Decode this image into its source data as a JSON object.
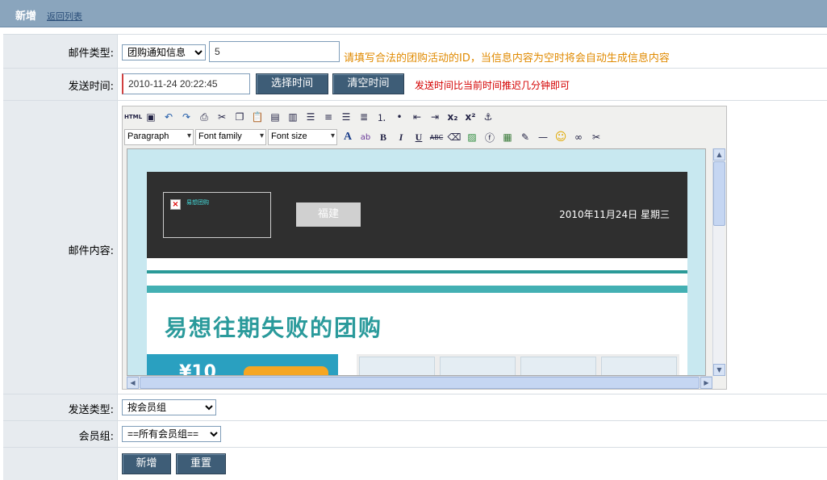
{
  "header": {
    "title": "新增",
    "back_link": "返回列表"
  },
  "mail_type": {
    "label": "邮件类型:",
    "select_value": "团购通知信息",
    "id_value": "5",
    "hint": "请填写合法的团购活动的ID，当信息内容为空时将会自动生成信息内容"
  },
  "send_time": {
    "label": "发送时间:",
    "value": "2010-11-24 20:22:45",
    "choose_button": "选择时间",
    "clear_button": "清空时间",
    "hint": "发送时间比当前时间推迟几分钟即可"
  },
  "content": {
    "label": "邮件内容:",
    "editor": {
      "format_select": "Paragraph",
      "font_family_select": "Font family",
      "font_size_select": "Font size",
      "toolbar_icons": [
        "html-icon",
        "fullscreen-icon",
        "undo-icon",
        "redo-icon",
        "print-icon",
        "cut-icon",
        "copy-icon",
        "paste-icon",
        "paste-text-icon",
        "paste-word-icon",
        "align-left-icon",
        "align-center-icon",
        "align-right-icon",
        "align-justify-icon",
        "ordered-list-icon",
        "unordered-list-icon",
        "outdent-icon",
        "indent-icon",
        "subscript-icon",
        "superscript-icon",
        "anchor-icon"
      ]
    },
    "preview": {
      "logo_text": "易想团购",
      "city_button": "福建",
      "date": "2010年11月24日  星期三",
      "heading": "易想往期失败的团购",
      "promo_text": "¥10"
    }
  },
  "send_type": {
    "label": "发送类型:",
    "value": "按会员组"
  },
  "member_group": {
    "label": "会员组:",
    "value": "==所有会员组=="
  },
  "actions": {
    "submit": "新增",
    "reset": "重置"
  },
  "colors": {
    "header_bg": "#8aa5bd",
    "button_bg": "#3e5d77",
    "hint_orange": "#e08a00",
    "hint_red": "#d40000",
    "accent_teal": "#2a9a9b"
  }
}
